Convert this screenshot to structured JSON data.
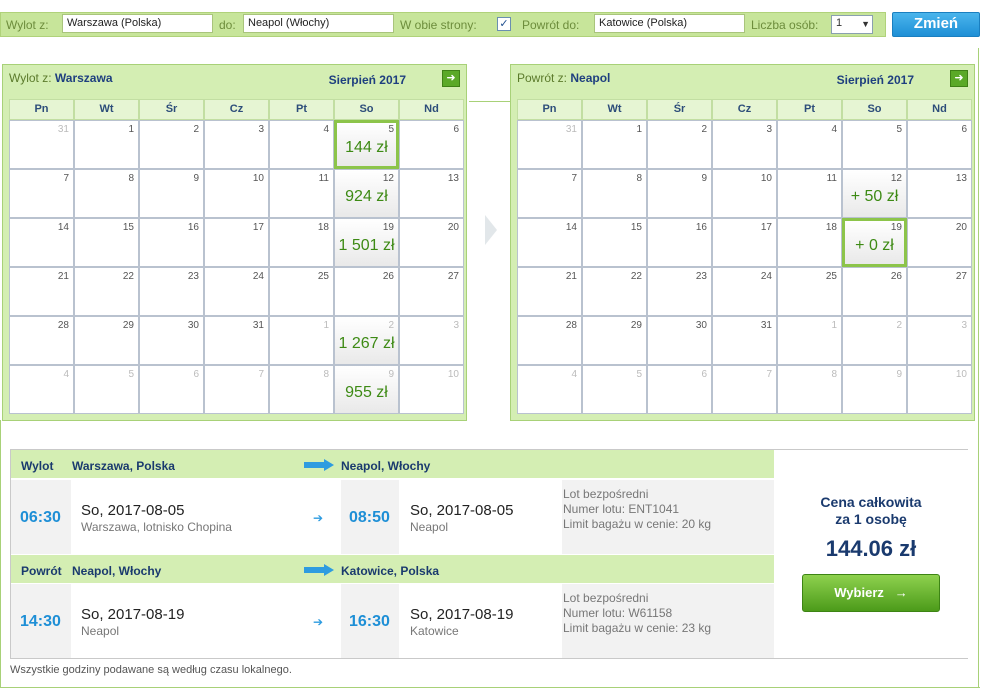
{
  "search": {
    "from_label": "Wylot z:",
    "from_value": "Warszawa (Polska)",
    "to_label": "do:",
    "to_value": "Neapol (Włochy)",
    "both_ways_label": "W obie strony:",
    "both_ways_checked": "✓",
    "return_label": "Powrót do:",
    "return_value": "Katowice (Polska)",
    "persons_label": "Liczba osób:",
    "persons_value": "1",
    "change_button": "Zmień"
  },
  "day_headers": [
    "Pn",
    "Wt",
    "Śr",
    "Cz",
    "Pt",
    "So",
    "Nd"
  ],
  "outbound_calendar": {
    "title_prefix": "Wylot z:",
    "title_city": "Warszawa",
    "month": "Sierpień 2017",
    "next_icon": "arrow-right-icon",
    "cells": [
      {
        "d": "31",
        "m": true
      },
      {
        "d": "1"
      },
      {
        "d": "2"
      },
      {
        "d": "3"
      },
      {
        "d": "4"
      },
      {
        "d": "5",
        "p": "144 zł",
        "sel": true
      },
      {
        "d": "6"
      },
      {
        "d": "7"
      },
      {
        "d": "8"
      },
      {
        "d": "9"
      },
      {
        "d": "10"
      },
      {
        "d": "11"
      },
      {
        "d": "12",
        "p": "924 zł"
      },
      {
        "d": "13"
      },
      {
        "d": "14"
      },
      {
        "d": "15"
      },
      {
        "d": "16"
      },
      {
        "d": "17"
      },
      {
        "d": "18"
      },
      {
        "d": "19",
        "p": "1 501 zł"
      },
      {
        "d": "20"
      },
      {
        "d": "21"
      },
      {
        "d": "22"
      },
      {
        "d": "23"
      },
      {
        "d": "24"
      },
      {
        "d": "25"
      },
      {
        "d": "26"
      },
      {
        "d": "27"
      },
      {
        "d": "28"
      },
      {
        "d": "29"
      },
      {
        "d": "30"
      },
      {
        "d": "31"
      },
      {
        "d": "1",
        "m": true
      },
      {
        "d": "2",
        "m": true,
        "p": "1 267 zł"
      },
      {
        "d": "3",
        "m": true
      },
      {
        "d": "4",
        "m": true
      },
      {
        "d": "5",
        "m": true
      },
      {
        "d": "6",
        "m": true
      },
      {
        "d": "7",
        "m": true
      },
      {
        "d": "8",
        "m": true
      },
      {
        "d": "9",
        "m": true,
        "p": "955 zł"
      },
      {
        "d": "10",
        "m": true
      }
    ]
  },
  "return_calendar": {
    "title_prefix": "Powrót z:",
    "title_city": "Neapol",
    "month": "Sierpień 2017",
    "next_icon": "arrow-right-icon",
    "cells": [
      {
        "d": "31",
        "m": true
      },
      {
        "d": "1"
      },
      {
        "d": "2"
      },
      {
        "d": "3"
      },
      {
        "d": "4"
      },
      {
        "d": "5"
      },
      {
        "d": "6"
      },
      {
        "d": "7"
      },
      {
        "d": "8"
      },
      {
        "d": "9"
      },
      {
        "d": "10"
      },
      {
        "d": "11"
      },
      {
        "d": "12",
        "p": "+ 50 zł"
      },
      {
        "d": "13"
      },
      {
        "d": "14"
      },
      {
        "d": "15"
      },
      {
        "d": "16"
      },
      {
        "d": "17"
      },
      {
        "d": "18"
      },
      {
        "d": "19",
        "p": "+ 0 zł",
        "sel": true
      },
      {
        "d": "20"
      },
      {
        "d": "21"
      },
      {
        "d": "22"
      },
      {
        "d": "23"
      },
      {
        "d": "24"
      },
      {
        "d": "25"
      },
      {
        "d": "26"
      },
      {
        "d": "27"
      },
      {
        "d": "28"
      },
      {
        "d": "29"
      },
      {
        "d": "30"
      },
      {
        "d": "31"
      },
      {
        "d": "1",
        "m": true
      },
      {
        "d": "2",
        "m": true
      },
      {
        "d": "3",
        "m": true
      },
      {
        "d": "4",
        "m": true
      },
      {
        "d": "5",
        "m": true
      },
      {
        "d": "6",
        "m": true
      },
      {
        "d": "7",
        "m": true
      },
      {
        "d": "8",
        "m": true
      },
      {
        "d": "9",
        "m": true
      },
      {
        "d": "10",
        "m": true
      }
    ]
  },
  "outbound": {
    "label": "Wylot",
    "from": "Warszawa, Polska",
    "to": "Neapol, Włochy",
    "dep_time": "06:30",
    "dep_date": "So, 2017-08-05",
    "dep_place": "Warszawa, lotnisko Chopina",
    "arr_time": "08:50",
    "arr_date": "So, 2017-08-05",
    "arr_place": "Neapol",
    "info1": "Lot bezpośredni",
    "info2": "Numer lotu: ENT1041",
    "info3": "Limit bagażu w cenie: 20 kg"
  },
  "return": {
    "label": "Powrót",
    "from": "Neapol, Włochy",
    "to": "Katowice, Polska",
    "dep_time": "14:30",
    "dep_date": "So, 2017-08-19",
    "dep_place": "Neapol",
    "arr_time": "16:30",
    "arr_date": "So, 2017-08-19",
    "arr_place": "Katowice",
    "info1": "Lot bezpośredni",
    "info2": "Numer lotu: W61158",
    "info3": "Limit bagażu w cenie: 23 kg"
  },
  "price": {
    "title_line1": "Cena całkowita",
    "title_line2": "za 1 osobę",
    "value": "144.06 zł",
    "button": "Wybierz",
    "button_icon": "→"
  },
  "footnote": "Wszystkie godziny podawane są według czasu lokalnego.",
  "colors": {
    "accent_green": "#8cc44a",
    "price_green": "#3d8a14",
    "accent_blue": "#1e8fd6",
    "navy": "#1a3a6e"
  }
}
